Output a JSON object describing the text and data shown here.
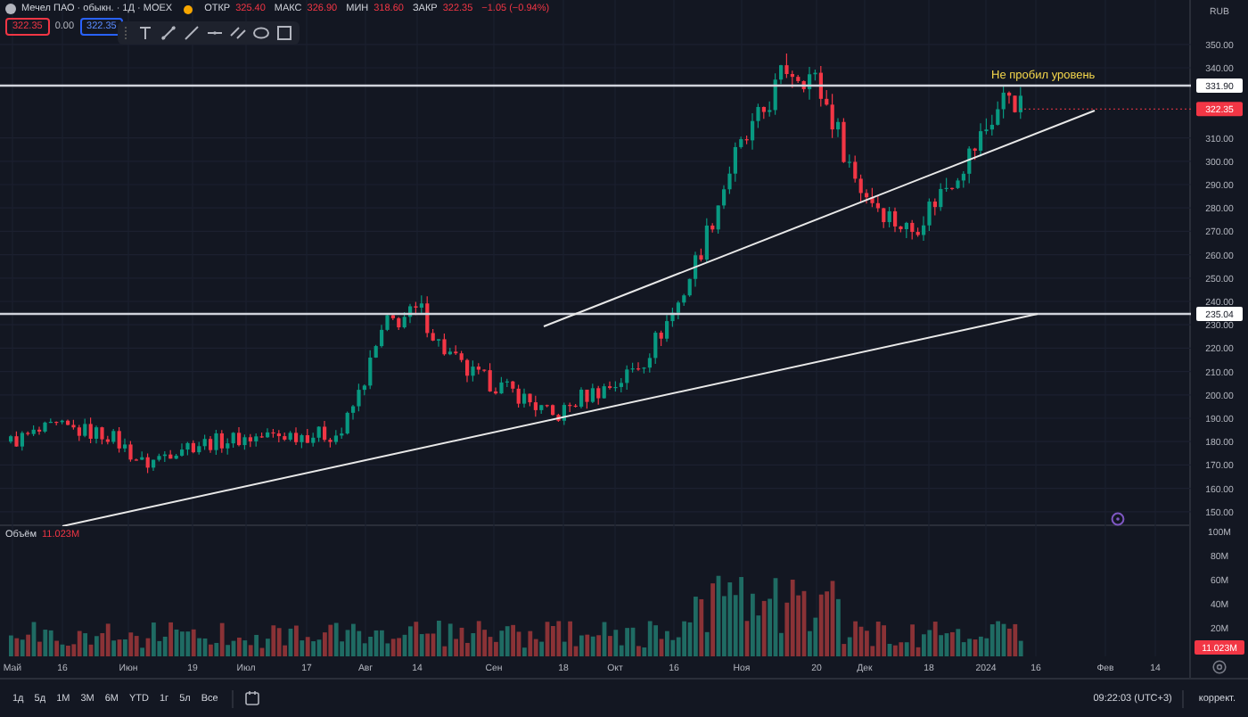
{
  "legend": {
    "symbol": "Мечел ПАО · обыкн. · 1Д · MOEX",
    "ohlc": [
      {
        "label": "ОТКР",
        "value": "325.40"
      },
      {
        "label": "МАКС",
        "value": "326.90"
      },
      {
        "label": "МИН",
        "value": "318.60"
      },
      {
        "label": "ЗАКР",
        "value": "322.35"
      }
    ],
    "change": "−1.05 (−0.94%)",
    "sell": "322.35",
    "spread": "0.00",
    "buy": "322.35"
  },
  "currency": "RUB",
  "annotation": "Не пробил уровень",
  "price_axis": {
    "ticks": [
      "350.00",
      "340.00",
      "310.00",
      "300.00",
      "290.00",
      "280.00",
      "270.00",
      "260.00",
      "250.00",
      "240.00",
      "230.00",
      "220.00",
      "210.00",
      "200.00",
      "190.00",
      "180.00",
      "170.00",
      "160.00",
      "150.00"
    ],
    "level_labels": [
      "331.90",
      "235.04"
    ],
    "last_price": "322.35"
  },
  "volume": {
    "label": "Объём",
    "value": "11.023M",
    "ticks": [
      "100M",
      "80M",
      "60M",
      "40M",
      "20M"
    ],
    "last_volume": "11.023M"
  },
  "time_axis": [
    "Май",
    "16",
    "Июн",
    "19",
    "Июл",
    "17",
    "Авг",
    "14",
    "Сен",
    "18",
    "Окт",
    "16",
    "Ноя",
    "20",
    "Дек",
    "18",
    "2024",
    "16",
    "Фев",
    "14"
  ],
  "ranges": [
    "1д",
    "5д",
    "1М",
    "3М",
    "6М",
    "YTD",
    "1г",
    "5л",
    "Все"
  ],
  "status": {
    "clock": "09:22:03 (UTC+3)",
    "adjust": "коррект."
  }
}
